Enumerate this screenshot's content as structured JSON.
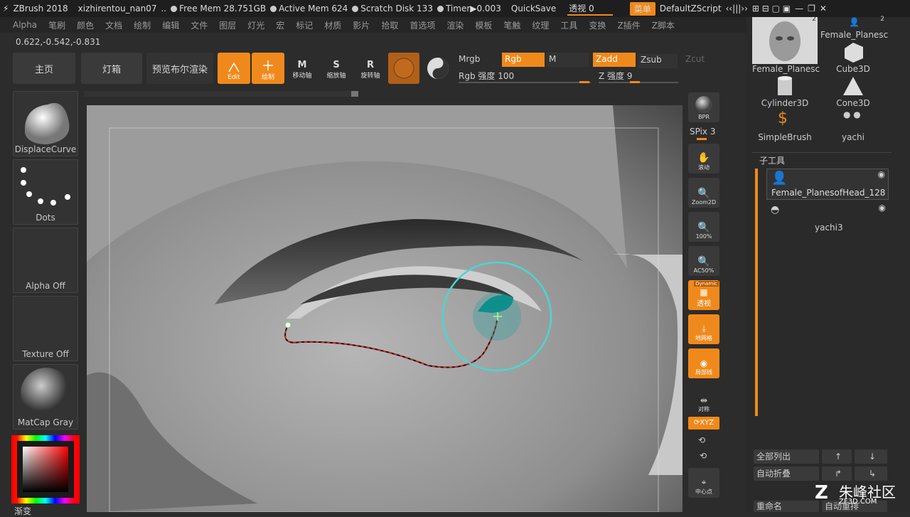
{
  "titlebar": {
    "app": "ZBrush 2018",
    "file": "xizhirentou_nan07",
    "sep": "..",
    "free_mem": "Free Mem 28.751GB",
    "active_mem": "Active Mem 624",
    "scratch": "Scratch Disk 133",
    "timer": "Timer▶0.003",
    "quicksave": "QuickSave",
    "transparency": "透视 0",
    "menu_btn": "菜单",
    "zscript": "DefaultZScript"
  },
  "menubar": [
    "Alpha",
    "笔刷",
    "颜色",
    "文档",
    "绘制",
    "编辑",
    "文件",
    "图层",
    "灯光",
    "宏",
    "标记",
    "材质",
    "影片",
    "拾取",
    "首选项",
    "渲染",
    "模板",
    "笔触",
    "纹理",
    "工具",
    "变换",
    "Z插件",
    "Z脚本"
  ],
  "coords": "0.622,-0.542,-0.831",
  "toolbar": {
    "home": "主页",
    "lightbox": "灯箱",
    "bpr": "预览布尔渲染",
    "edit": "Edit",
    "draw": "绘制",
    "move": "移动轴",
    "scale": "缩放轴",
    "rotate": "旋转轴",
    "mrgb": "Mrgb",
    "rgb": "Rgb",
    "m": "M",
    "zadd": "Zadd",
    "zsub": "Zsub",
    "zcut": "Zcut",
    "rgb_intensity": "Rgb 强度 100",
    "z_intensity": "Z 强度 9"
  },
  "left": {
    "brush": "DisplaceCurve",
    "stroke": "Dots",
    "alpha": "Alpha Off",
    "texture": "Texture Off",
    "material": "MatCap Gray",
    "gradient": "渐变"
  },
  "right": {
    "bpr": "BPR",
    "spix": "SPix 3",
    "scroll": "滚动",
    "zoom2d": "Zoom2D",
    "p100": "100%",
    "ac50": "AC50%",
    "persp": "透视",
    "dynamic": "Dynamic",
    "floor": "地网格",
    "local": "局部线",
    "sym": "对称",
    "xyz": "XYZ",
    "center": "中心点"
  },
  "side": {
    "tools": [
      "Female_Planesc",
      "Female_Planesc",
      "Cube3D",
      "Cylinder3D",
      "Cone3D",
      "SimpleBrush",
      "yachi"
    ],
    "subtool_title": "子工具",
    "subtools": [
      "Female_PlanesofHead_128",
      "yachi3"
    ],
    "list_all": "全部列出",
    "autocollapse": "自动折叠",
    "rename": "重命名",
    "autoreorder": "自动重排",
    "badge_2": "2"
  },
  "watermark": {
    "cn": "朱峰社区",
    "url": "ZF3D.COM"
  }
}
